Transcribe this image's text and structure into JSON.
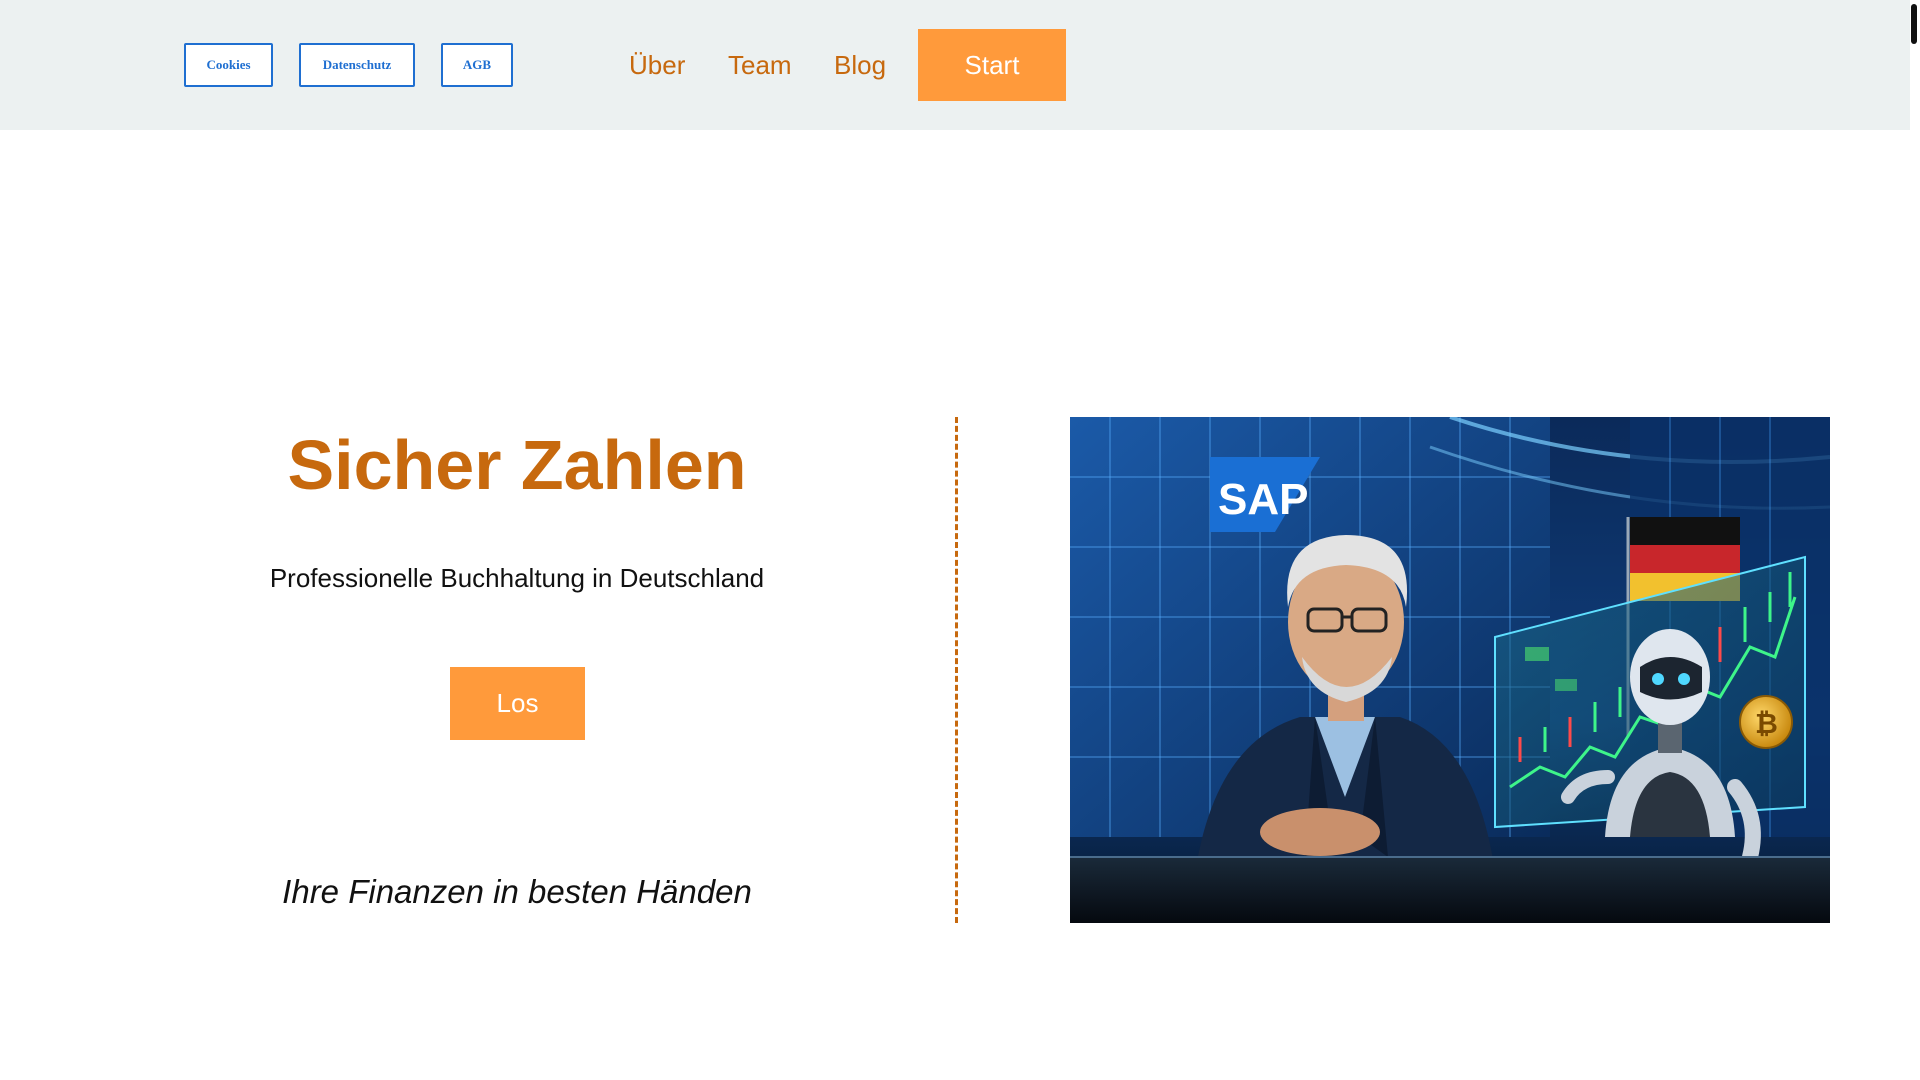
{
  "header": {
    "legal_buttons": {
      "cookies": "Cookies",
      "datenschutz": "Datenschutz",
      "agb": "AGB"
    },
    "nav": {
      "ueber": "Über",
      "team": "Team",
      "blog": "Blog"
    },
    "start_label": "Start"
  },
  "hero": {
    "title": "Sicher Zahlen",
    "subtitle": "Professionelle Buchhaltung in Deutschland",
    "cta_label": "Los",
    "tagline": "Ihre Finanzen in besten Händen"
  },
  "image": {
    "sign_text": "SAP",
    "coin_symbol": "₿"
  },
  "colors": {
    "accent_orange": "#ff9a3b",
    "brand_text_orange": "#c7690e",
    "link_blue": "#1f6fd1",
    "header_bg": "#ecf1f1"
  }
}
